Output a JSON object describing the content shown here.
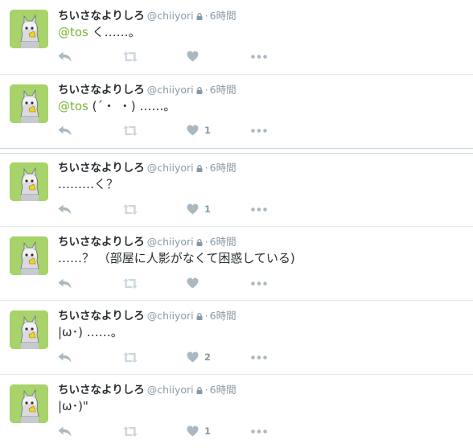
{
  "user": {
    "name": "ちいさなよりしろ",
    "handle": "@chiiyori",
    "separator": "·",
    "avatar_bg": "#a8d26a"
  },
  "colors": {
    "mention": "#7bb33a",
    "icon": "#aab8c2",
    "meta": "#8899a6"
  },
  "tweets": [
    {
      "time": "6時間",
      "mention": "@tos",
      "text": " く……。",
      "likes": ""
    },
    {
      "time": "6時間",
      "mention": "@tos",
      "text": " (´・ ・) ……。",
      "likes": "1"
    },
    {
      "time": "6時間",
      "mention": "",
      "text": "………く？",
      "likes": "1"
    },
    {
      "time": "6時間",
      "mention": "",
      "text": "……？ （部屋に人影がなくて困惑している)",
      "likes": ""
    },
    {
      "time": "6時間",
      "mention": "",
      "text": "|ω･) ……。",
      "likes": "2"
    },
    {
      "time": "6時間",
      "mention": "",
      "text": "|ω･)\"",
      "likes": "1"
    }
  ],
  "icons": {
    "reply": "reply-icon",
    "retweet": "retweet-icon",
    "like": "heart-icon",
    "more": "more-icon",
    "lock": "lock-icon"
  }
}
